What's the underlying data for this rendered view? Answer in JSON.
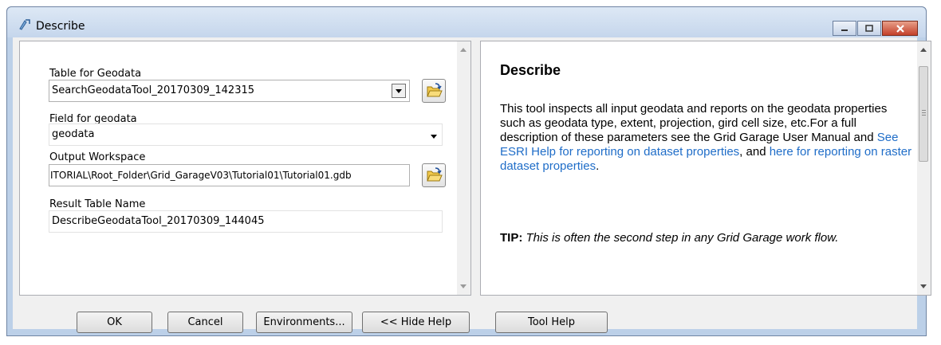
{
  "window": {
    "title": "Describe"
  },
  "form": {
    "table_label": "Table for Geodata",
    "table_value": "SearchGeodataTool_20170309_142315",
    "field_label": "Field for geodata",
    "field_value": "geodata",
    "workspace_label": "Output Workspace",
    "workspace_value": "ITORIAL\\Root_Folder\\Grid_GarageV03\\Tutorial01\\Tutorial01.gdb",
    "result_label": "Result Table Name",
    "result_value": "DescribeGeodataTool_20170309_144045"
  },
  "help": {
    "title": "Describe",
    "p1_text": "This tool inspects all input geodata and reports on the geodata properties such as geodata type, extent, projection, gird cell size, etc.For a full description of these parameters see the Grid Garage User Manual and ",
    "p1_link1": "See ESRI Help for reporting on dataset properties",
    "p1_mid": ", and ",
    "p1_link2": "here for reporting on raster dataset properties",
    "p1_end": ".",
    "tip_label": "TIP:",
    "tip_text": " This is often the second step in any Grid Garage work flow."
  },
  "buttons": {
    "ok": "OK",
    "cancel": "Cancel",
    "environments": "Environments...",
    "hide_help": "<< Hide Help",
    "tool_help": "Tool Help"
  },
  "colors": {
    "link": "#1f6dc8",
    "titlebar": "#c5d6ec",
    "close": "#c4402a"
  }
}
